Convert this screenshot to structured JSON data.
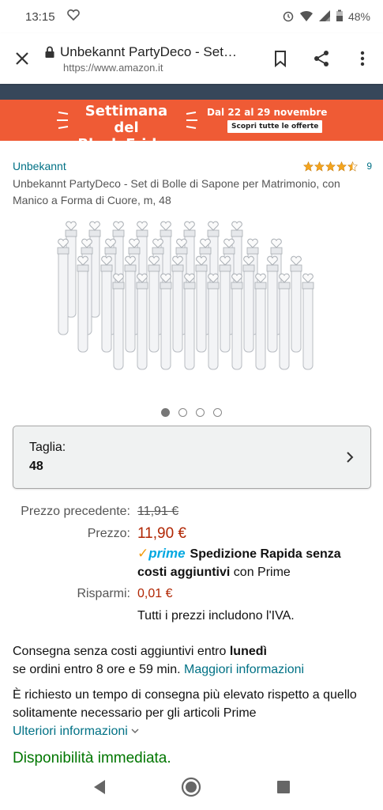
{
  "status_bar": {
    "time": "13:15",
    "battery": "48%"
  },
  "browser": {
    "page_title": "Unbekannt PartyDeco - Set…",
    "url": "https://www.amazon.it"
  },
  "banner": {
    "title_line1": "Settimana del",
    "title_line2": "Black Friday",
    "dates": "Dal 22 al 29 novembre",
    "cta": "Scopri tutte le offerte",
    "bg_color": "#ef5b35"
  },
  "product": {
    "brand": "Unbekannt",
    "rating_stars": 4.5,
    "rating_count": "9",
    "title": "Unbekannt PartyDeco - Set di Bolle di Sapone per Matrimonio, con Manico a Forma di Cuore, m, 48",
    "image_alt": "heart-handled soap bubble tubes",
    "carousel_total": 4,
    "carousel_active": 1
  },
  "size_selector": {
    "label": "Taglia:",
    "value": "48"
  },
  "pricing": {
    "prev_label": "Prezzo precedente:",
    "prev_value": "11,91 €",
    "price_label": "Prezzo:",
    "price_value": "11,90 €",
    "prime_logo": "prime",
    "prime_bold": "Spedizione Rapida senza costi aggiuntivi",
    "prime_rest": " con Prime",
    "save_label": "Risparmi:",
    "save_value": "0,01 €",
    "vat_note": "Tutti i prezzi includono l'IVA."
  },
  "delivery": {
    "line1_pre": "Consegna senza costi aggiuntivi entro ",
    "line1_bold": "lunedì",
    "line2_pre": "se ordini entro 8 ore e 59 min. ",
    "line2_link": "Maggiori informazioni"
  },
  "notice": {
    "text": "È richiesto un tempo di consegna più elevato rispetto a quello solitamente necessario per gli articoli Prime",
    "link": "Ulteriori informazioni"
  },
  "availability": "Disponibilità immediata.",
  "colors": {
    "link": "#007185",
    "price_red": "#b12704",
    "in_stock_green": "#007600",
    "prime_blue": "#00a8e1"
  }
}
